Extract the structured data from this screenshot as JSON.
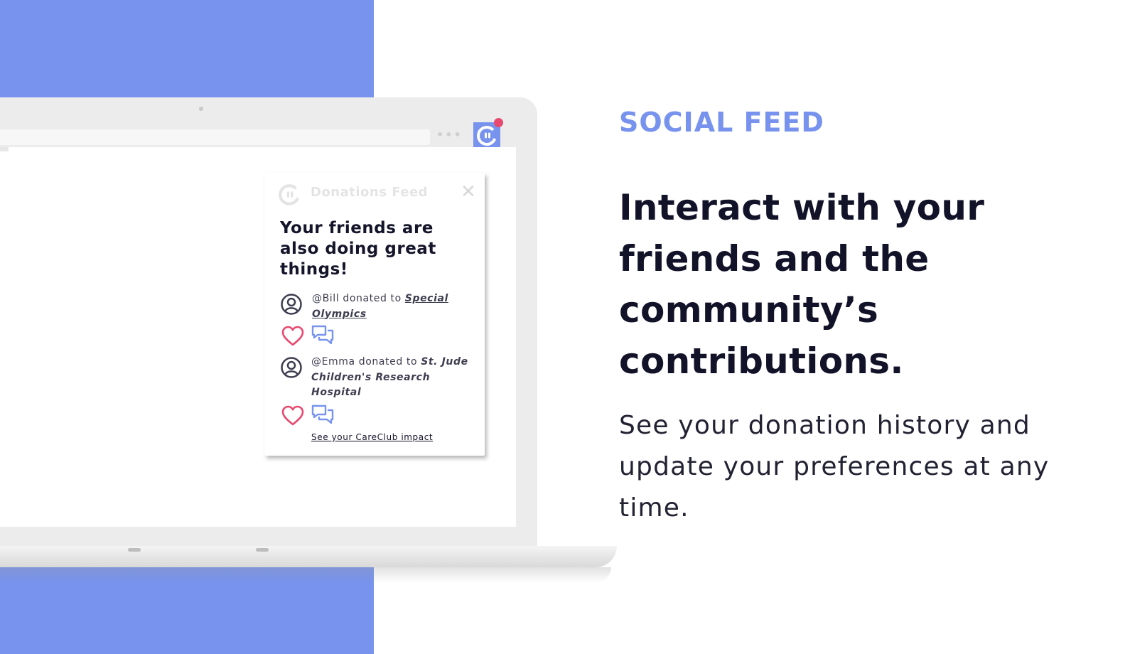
{
  "colors": {
    "accent": "#7893ee",
    "heart": "#e8496f",
    "dark_text": "#121228"
  },
  "icons": [
    "careclub-logo-icon",
    "close-icon",
    "user-avatar-icon",
    "heart-icon",
    "comment-icon"
  ],
  "popup": {
    "title": "Donations Feed",
    "close": "✕",
    "headline": "Your friends are also doing great things!",
    "feed": [
      {
        "user": "@Bill",
        "action": " donated to ",
        "org": "Special Olympics"
      },
      {
        "user": "@Emma",
        "action": " donated to  ",
        "org": "St. Jude Children's Research Hospital"
      }
    ],
    "impact_link": "See your CareClub impact"
  },
  "browser": {
    "menu_dots": "•••"
  },
  "section": {
    "eyebrow": "SOCIAL FEED",
    "headline": "Interact with your friends and the community’s contributions.",
    "subcopy": "See your donation history and update your preferences at any time."
  }
}
